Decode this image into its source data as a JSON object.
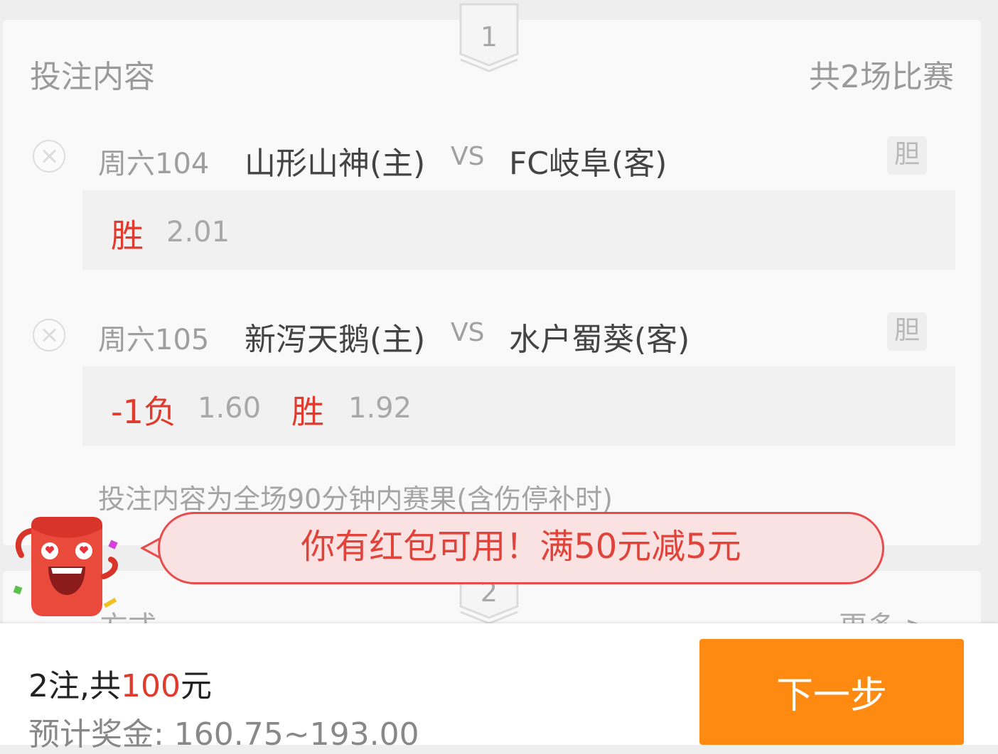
{
  "bet_section": {
    "step_number": "1",
    "title": "投注内容",
    "match_count": "共2场比赛",
    "matches": [
      {
        "match_no": "周六104",
        "home": "山形山神(主)",
        "vs": "VS",
        "away": "FC岐阜(客)",
        "banker_label": "胆",
        "picks": [
          {
            "label": "胜",
            "odds": "2.01"
          }
        ]
      },
      {
        "match_no": "周六105",
        "home": "新泻天鹅(主)",
        "vs": "VS",
        "away": "水户蜀葵(客)",
        "banker_label": "胆",
        "picks": [
          {
            "label": "-1负",
            "odds": "1.60"
          },
          {
            "label": "胜",
            "odds": "1.92"
          }
        ]
      }
    ],
    "note": "投注内容为全场90分钟内赛果(含伤停补时)"
  },
  "play_section": {
    "step_number": "2",
    "title": "方式",
    "more_label": "更多 >"
  },
  "promo": {
    "message": "你有红包可用！满50元减5元"
  },
  "footer": {
    "summary_prefix": "2注,共",
    "summary_amount": "100",
    "summary_suffix": "元",
    "prize_estimate": "预计奖金: 160.75~193.00",
    "next_label": "下一步"
  },
  "colors": {
    "accent_red": "#e03b2e",
    "button_orange": "#ff8a12",
    "bubble_bg": "#fbe2e2",
    "bubble_border": "#e84b4b"
  }
}
